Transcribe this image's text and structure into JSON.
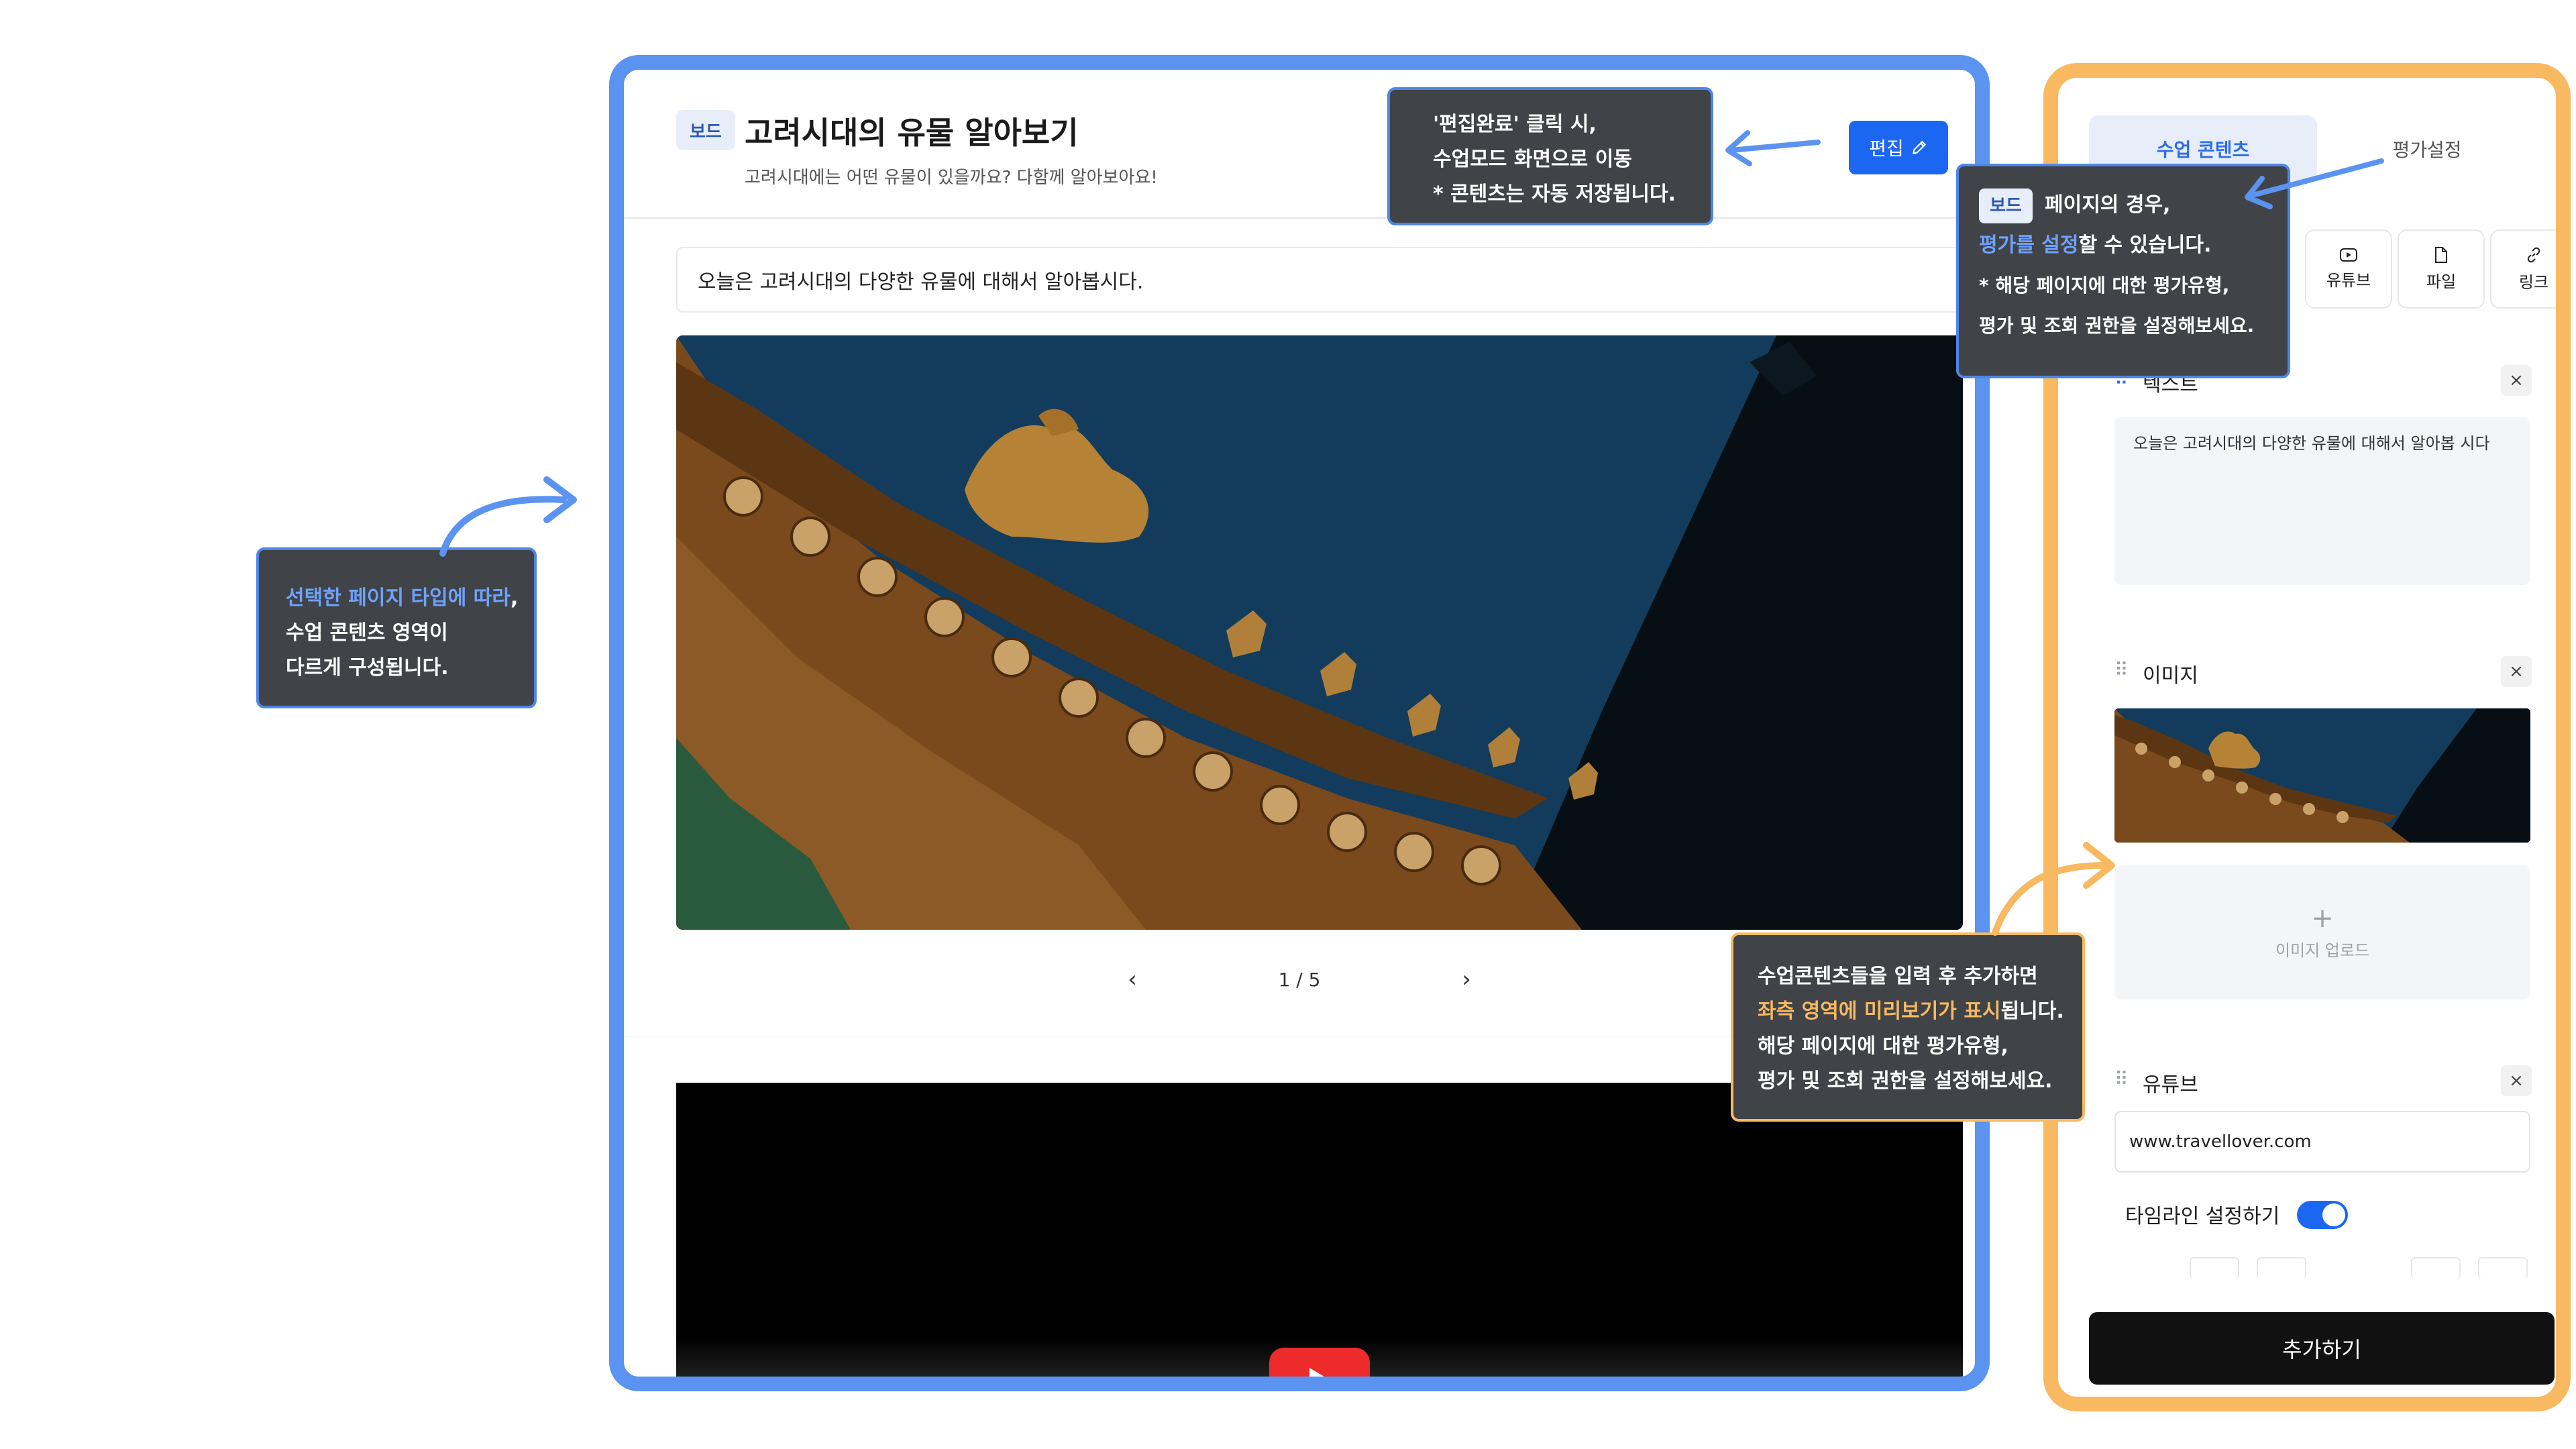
{
  "preview": {
    "badge": "보드",
    "title": "고려시대의 유물 알아보기",
    "subtitle": "고려시대에는 어떤 유물이 있을까요? 다함께 알아보아요!",
    "edit_label": "편집",
    "intro_text": "오늘은 고려시대의 다양한 유물에 대해서 알아봅시다.",
    "pagination": {
      "prev": "‹",
      "indicator": "1 / 5",
      "next": "›"
    }
  },
  "editor": {
    "tabs": [
      {
        "label": "수업 콘텐츠"
      },
      {
        "label": "평가설정"
      }
    ],
    "types": [
      {
        "label": "유튜브"
      },
      {
        "label": "파일"
      },
      {
        "label": "링크"
      }
    ],
    "blocks": {
      "text": {
        "title": "텍스트",
        "content": "오늘은 고려시대의 다양한 유물에 대해서 알아봅 시다"
      },
      "image": {
        "title": "이미지",
        "upload_label": "이미지 업로드",
        "upload_plus": "+"
      },
      "youtube": {
        "title": "유튜브",
        "url": "www.travellover.com"
      }
    },
    "timeline": {
      "label": "타임라인 설정하기",
      "enabled": true
    },
    "add_label": "추가하기",
    "close_glyph": "×",
    "grip_glyph": "⠿"
  },
  "callouts": {
    "page_type": {
      "line1": "선택한 페이지 타입에 따라,",
      "line1_hl": "선택한 페이지 타입에 따라",
      "line1_rest": ",",
      "line2": "수업 콘텐츠 영역이",
      "line3": "다르게 구성됩니다."
    },
    "edit_done": {
      "line1": "'편집완료' 클릭 시,",
      "line2": "수업모드 화면으로 이동",
      "line3": "* 콘텐츠는 자동 저장됩니다."
    },
    "board_eval": {
      "badge": "보드",
      "line1": "페이지의 경우,",
      "line2_hl": "평가를 설정",
      "line2_rest": "할 수 있습니다.",
      "line3": "* 해당 페이지에 대한 평가유형,",
      "line4": "평가 및 조회 권한을 설정해보세요."
    },
    "preview": {
      "line1": "수업콘텐츠들을 입력 후 추가하면",
      "line2_hl": "좌측 영역에 미리보기가 표시",
      "line2_rest": "됩니다.",
      "line3": "해당 페이지에 대한 평가유형,",
      "line4": "평가 및 조회 권한을 설정해보세요."
    }
  },
  "colors": {
    "blue_frame": "#5b93f0",
    "orange_frame": "#f8b960",
    "accent": "#1c67f2"
  }
}
